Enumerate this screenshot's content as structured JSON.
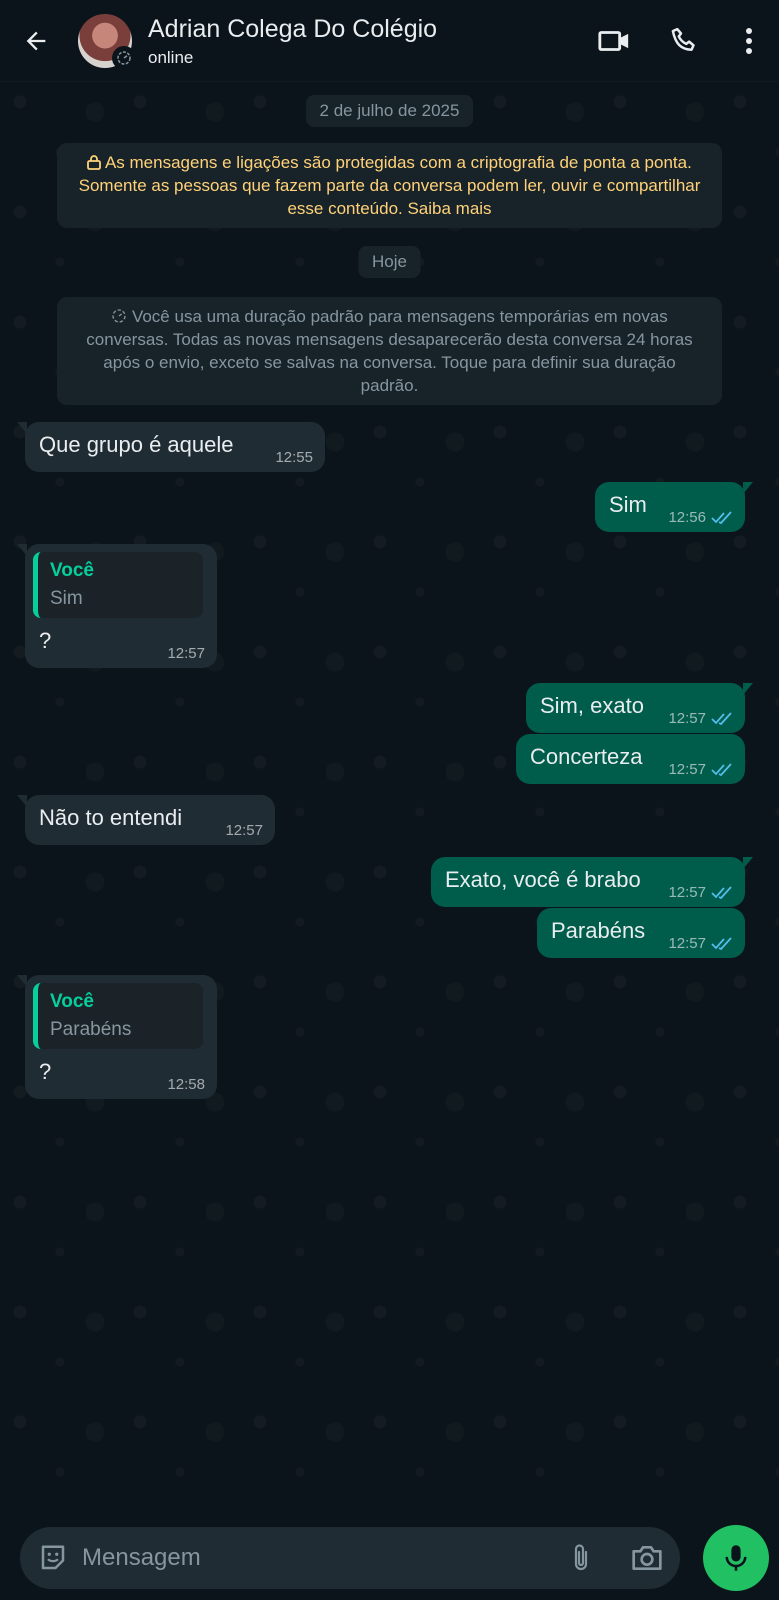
{
  "header": {
    "contact_name": "Adrian Colega Do Colégio",
    "status": "online"
  },
  "date_pill": "2 de julho de 2025",
  "encryption_notice": "As mensagens e ligações são protegidas com a criptografia de ponta a ponta. Somente as pessoas que fazem parte da conversa podem ler, ouvir e compartilhar esse conteúdo. Saiba mais",
  "today_pill": "Hoje",
  "temp_notice": "Você usa uma duração padrão para mensagens temporárias em novas conversas. Todas as novas mensagens desaparecerão desta conversa 24 horas após o envio, exceto se salvas na conversa. Toque para definir sua duração padrão.",
  "messages": [
    {
      "dir": "in",
      "text": "Que grupo é aquele",
      "time": "12:55"
    },
    {
      "dir": "out",
      "text": "Sim",
      "time": "12:56",
      "read": true
    },
    {
      "dir": "in",
      "quote_author": "Você",
      "quote_text": "Sim",
      "text": "?",
      "time": "12:57"
    },
    {
      "dir": "out",
      "text": "Sim, exato",
      "time": "12:57",
      "read": true
    },
    {
      "dir": "out",
      "text": "Concerteza",
      "time": "12:57",
      "read": true
    },
    {
      "dir": "in",
      "text": "Não to entendi",
      "time": "12:57"
    },
    {
      "dir": "out",
      "text": "Exato, você é brabo",
      "time": "12:57",
      "read": true
    },
    {
      "dir": "out",
      "text": "Parabéns",
      "time": "12:57",
      "read": true
    },
    {
      "dir": "in",
      "quote_author": "Você",
      "quote_text": "Parabéns",
      "text": "?",
      "time": "12:58"
    }
  ],
  "composer": {
    "placeholder": "Mensagem"
  },
  "colors": {
    "background": "#0b141a",
    "incoming_bubble": "#202c33",
    "outgoing_bubble": "#005c4b",
    "accent_green": "#21c063",
    "read_ticks": "#53bdeb",
    "encryption_text": "#ffd279"
  },
  "icons": [
    "back-arrow-icon",
    "video-call-icon",
    "phone-call-icon",
    "more-options-icon",
    "lock-icon",
    "timer-icon",
    "double-check-icon",
    "emoji-icon",
    "attach-icon",
    "camera-icon",
    "mic-icon"
  ]
}
